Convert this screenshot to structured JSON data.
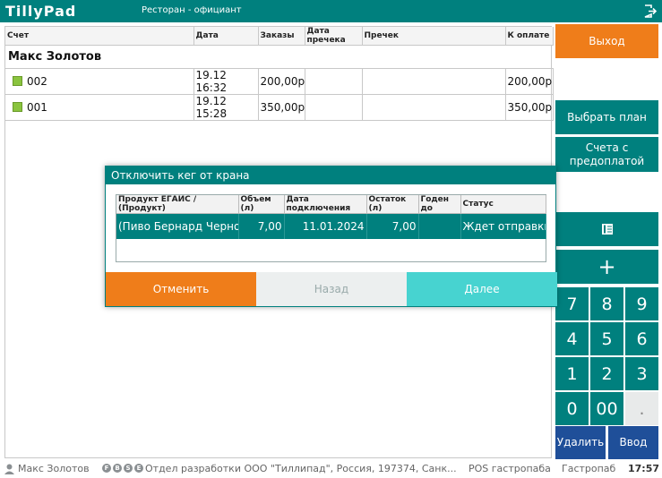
{
  "header": {
    "logo": "TillyPad",
    "title": "Ресторан - официант"
  },
  "orders": {
    "columns": [
      "Счет",
      "Дата",
      "Заказы",
      "Дата пречека",
      "Пречек",
      "К оплате"
    ],
    "waiter": "Макс Золотов",
    "rows": [
      {
        "bill": "002",
        "date": "19.12 16:32",
        "orders": "200,00р",
        "precheck_date": "",
        "precheck": "",
        "to_pay": "200,00р"
      },
      {
        "bill": "001",
        "date": "19.12 15:28",
        "orders": "350,00р",
        "precheck_date": "",
        "precheck": "",
        "to_pay": "350,00р"
      }
    ]
  },
  "right_panel": {
    "exit": "Выход",
    "choose_plan": "Выбрать план",
    "prepaid_bills": "Счета с предоплатой",
    "plus": "+",
    "keys": [
      "7",
      "8",
      "9",
      "4",
      "5",
      "6",
      "1",
      "2",
      "3",
      "0",
      "00",
      "."
    ],
    "delete": "Удалить",
    "enter": "Ввод"
  },
  "dialog": {
    "title": "Отключить кег от крана",
    "columns": [
      "Продукт ЕГАИС / (Продукт)",
      "Объем (л)",
      "Дата подключения",
      "Остаток (л)",
      "Годен до",
      "Статус"
    ],
    "row": {
      "product": "(Пиво Бернард Черно",
      "volume": "7,00",
      "connected": "11.01.2024",
      "remaining": "7,00",
      "expires": "",
      "status": "Ждет отправки"
    },
    "cancel": "Отменить",
    "back": "Назад",
    "next": "Далее"
  },
  "status_bar": {
    "user": "Макс Золотов",
    "badges": [
      "F",
      "B",
      "S",
      "E"
    ],
    "org": "Отдел разработки ООО \"Тиллипад\", Россия, 197374, Санк...",
    "pos": "POS гастропаба",
    "place": "Гастропаб",
    "time": "17:57"
  },
  "colors": {
    "teal": "#00807e",
    "orange": "#ef7d1a",
    "blue": "#1f4f99",
    "light_teal": "#47d3d0",
    "bill_marker": "#8ac43f"
  }
}
